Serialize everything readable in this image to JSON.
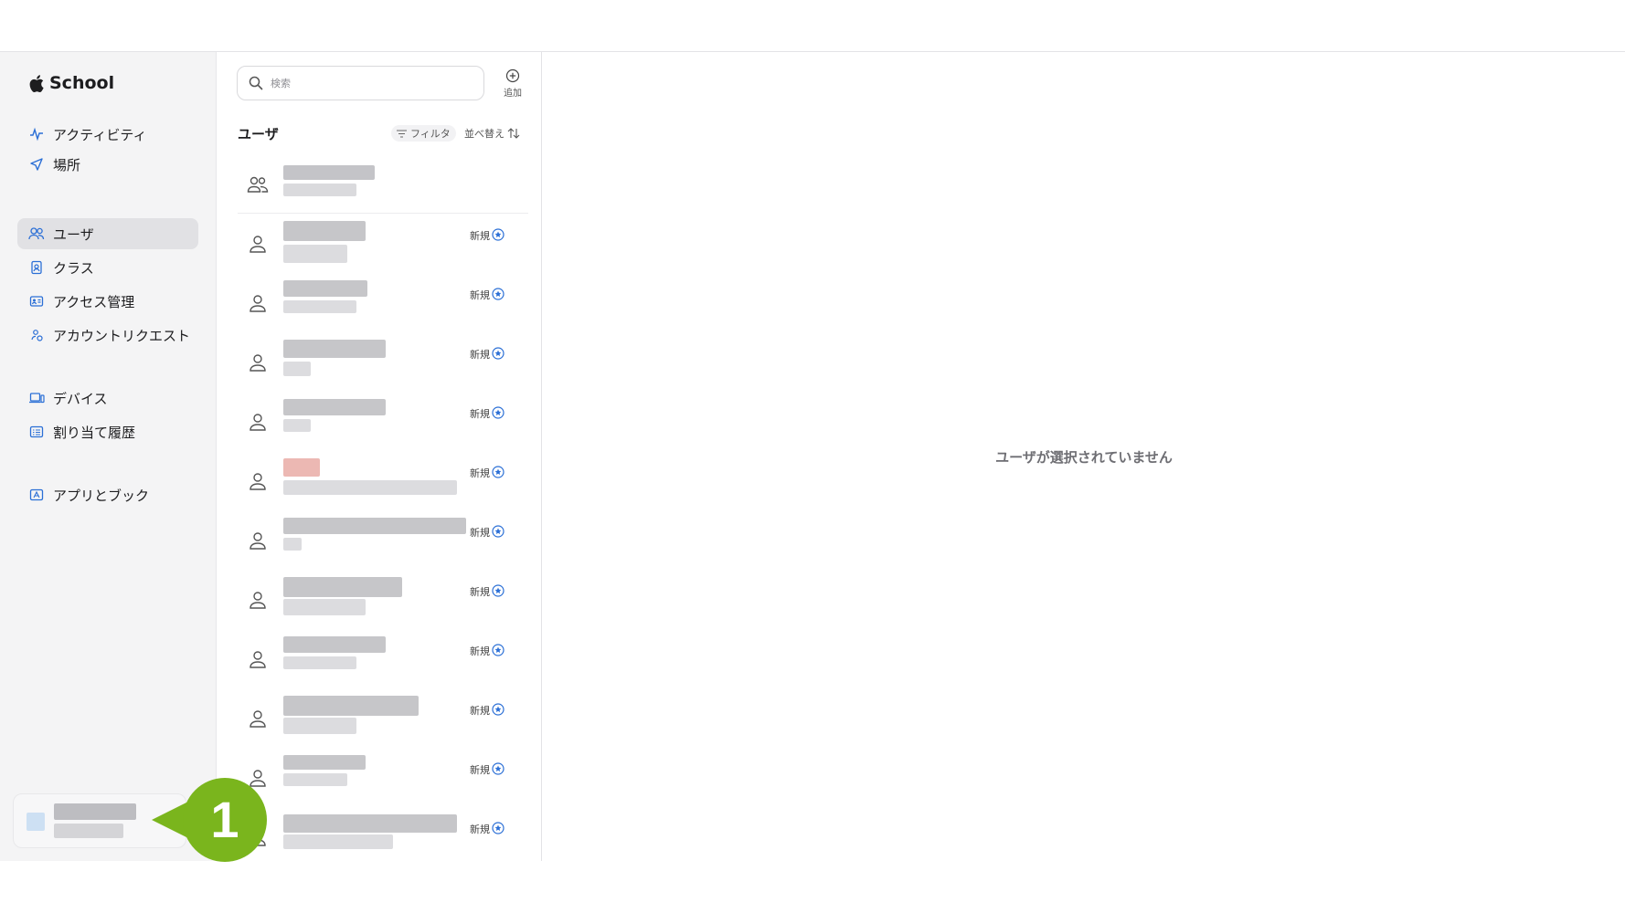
{
  "app": {
    "brand": "School"
  },
  "sidebar": {
    "items": [
      {
        "label": "アクティビティ",
        "icon": "activity-icon"
      },
      {
        "label": "場所",
        "icon": "location-arrow-icon"
      },
      {
        "label": "ユーザ",
        "icon": "users-icon",
        "active": true
      },
      {
        "label": "クラス",
        "icon": "class-icon"
      },
      {
        "label": "アクセス管理",
        "icon": "id-card-icon"
      },
      {
        "label": "アカウントリクエスト",
        "icon": "account-request-icon"
      },
      {
        "label": "デバイス",
        "icon": "laptop-icon"
      },
      {
        "label": "割り当て履歴",
        "icon": "history-list-icon"
      },
      {
        "label": "アプリとブック",
        "icon": "apps-books-icon"
      }
    ]
  },
  "list": {
    "search_placeholder": "検索",
    "add_label": "追加",
    "title": "ユーザ",
    "filter_label": "フィルタ",
    "sort_label": "並べ替え",
    "new_badge": "新規"
  },
  "detail": {
    "empty_message": "ユーザが選択されていません"
  },
  "callout": {
    "number": "1",
    "color": "#7ab51d"
  },
  "colors": {
    "accent": "#2b6fd6",
    "active_bg": "#e1e1e4"
  }
}
